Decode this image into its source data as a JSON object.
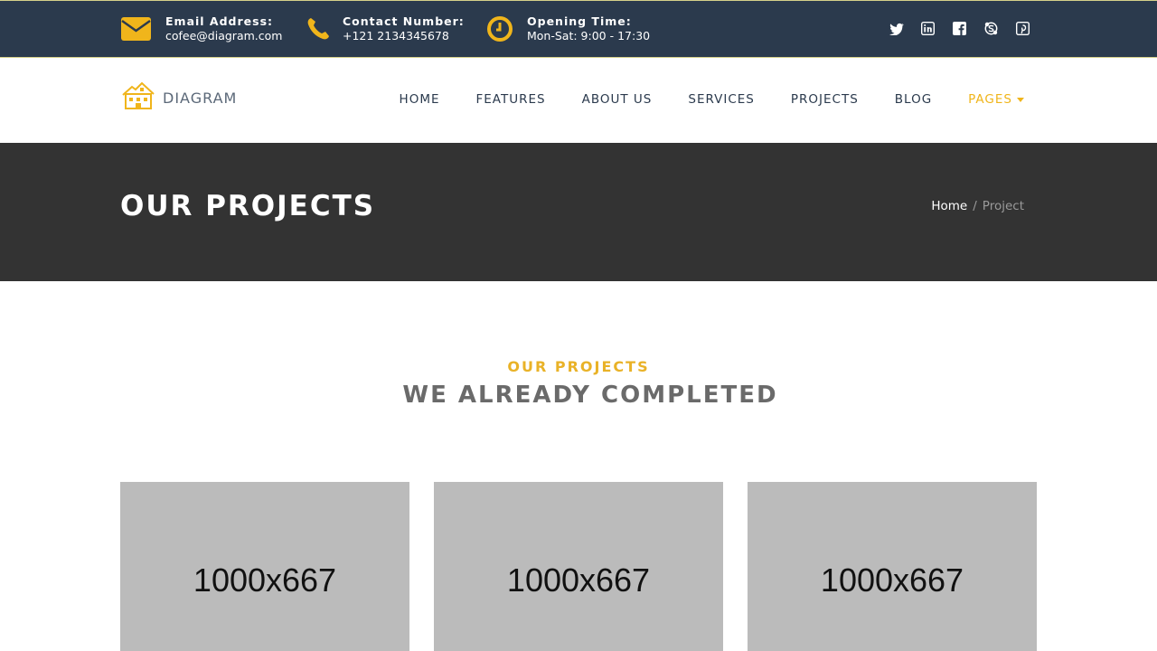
{
  "topbar": {
    "email": {
      "label": "Email Address:",
      "value": "cofee@diagram.com",
      "icon": "envelope-icon"
    },
    "phone": {
      "label": "Contact Number:",
      "value": "+121 2134345678",
      "icon": "phone-icon"
    },
    "hours": {
      "label": "Opening Time:",
      "value": "Mon-Sat: 9:00 - 17:30",
      "icon": "clock-icon"
    },
    "social": [
      "twitter-icon",
      "linkedin-icon",
      "facebook-icon",
      "skype-icon",
      "pinterest-icon"
    ]
  },
  "brand": {
    "name": "DIAGRAM",
    "icon": "house-logo-icon"
  },
  "nav": {
    "items": [
      {
        "label": "HOME"
      },
      {
        "label": "FEATURES"
      },
      {
        "label": "ABOUT US"
      },
      {
        "label": "SERVICES"
      },
      {
        "label": "PROJECTS"
      },
      {
        "label": "BLOG"
      },
      {
        "label": "PAGES"
      }
    ],
    "active_index": 6
  },
  "page_header": {
    "title": "OUR PROJECTS",
    "breadcrumb": {
      "home": "Home",
      "separator": "/",
      "current": "Project"
    }
  },
  "section": {
    "subtitle": "OUR PROJECTS",
    "title": "WE ALREADY COMPLETED"
  },
  "projects": [
    {
      "placeholder": "1000x667"
    },
    {
      "placeholder": "1000x667"
    },
    {
      "placeholder": "1000x667"
    }
  ],
  "colors": {
    "topbar_bg": "#2b3a4d",
    "accent": "#f0b51b",
    "header_bg": "#333333",
    "placeholder_bg": "#bbbbbb"
  }
}
